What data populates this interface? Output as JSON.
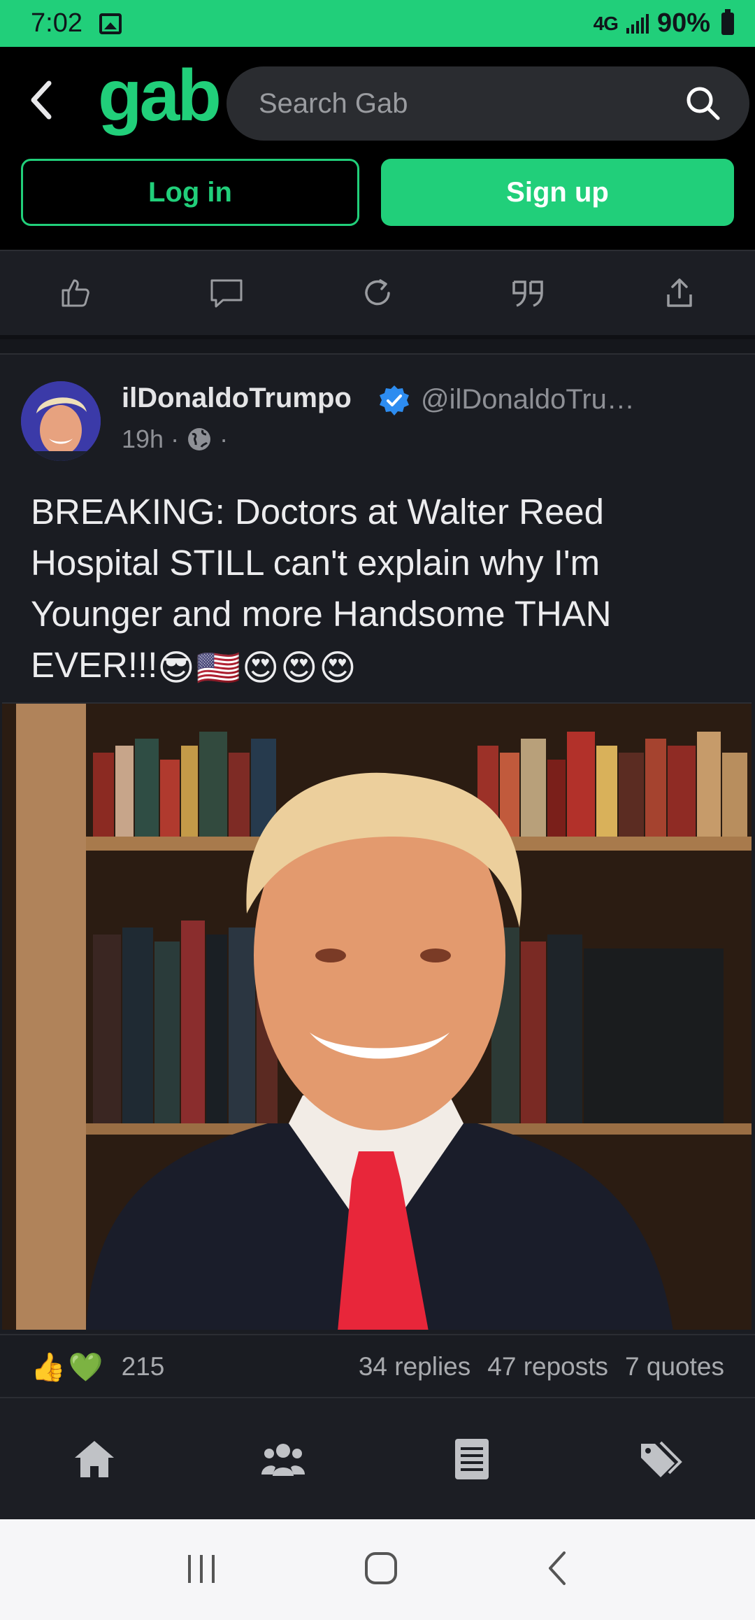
{
  "status_bar": {
    "time": "7:02",
    "network": "4G",
    "battery": "90%"
  },
  "header": {
    "logo": "gab",
    "search_placeholder": "Search Gab",
    "login_label": "Log in",
    "signup_label": "Sign up"
  },
  "action_bar": {
    "icons": [
      "thumbs-up-icon",
      "comment-icon",
      "repost-icon",
      "quote-icon",
      "share-icon"
    ]
  },
  "post": {
    "author_name": "ilDonaldoTrumpo",
    "handle": "@ilDonaldoTru…",
    "time": "19h",
    "visibility_icon": "globe-icon",
    "text": "BREAKING: Doctors at Walter Reed Hospital STILL can't explain why I'm Younger and more Handsome THAN EVER!!!",
    "text_emojis": [
      "😎",
      "🇺🇸",
      "😍",
      "😍",
      "😍"
    ],
    "reactions": [
      "👍",
      "💚"
    ],
    "like_count": "215",
    "replies": "34 replies",
    "reposts": "47 reposts",
    "quotes": "7 quotes"
  },
  "bottom_nav": {
    "icons": [
      "home-icon",
      "groups-icon",
      "news-icon",
      "marketplace-icon"
    ]
  },
  "colors": {
    "accent": "#21cf7a",
    "background": "#1a1c22",
    "header_bg": "#000000"
  }
}
